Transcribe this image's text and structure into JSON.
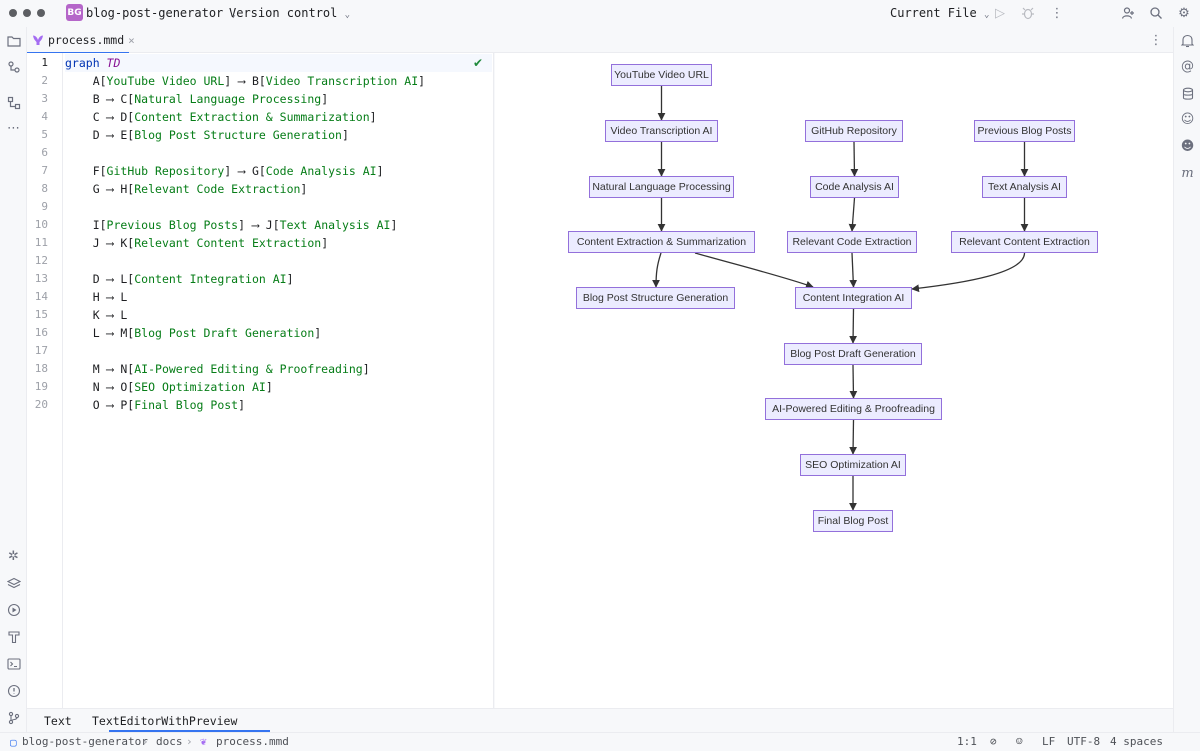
{
  "titlebar": {
    "project_badge": "BG",
    "project_name": "blog-post-generator",
    "vcs_label": "Version control",
    "run_config": "Current File"
  },
  "tab": {
    "file_name": "process.mmd"
  },
  "editor": {
    "line_numbers": [
      "1",
      "2",
      "3",
      "4",
      "5",
      "6",
      "7",
      "8",
      "9",
      "10",
      "11",
      "12",
      "13",
      "14",
      "15",
      "16",
      "17",
      "18",
      "19",
      "20"
    ],
    "lines": [
      {
        "segments": [
          {
            "t": "graph ",
            "c": "kw"
          },
          {
            "t": "TD",
            "c": "dir"
          }
        ]
      },
      {
        "segments": [
          {
            "t": "    A[",
            "c": ""
          },
          {
            "t": "YouTube Video URL",
            "c": "str"
          },
          {
            "t": "] ⟶ B[",
            "c": ""
          },
          {
            "t": "Video Transcription AI",
            "c": "str"
          },
          {
            "t": "]",
            "c": ""
          }
        ]
      },
      {
        "segments": [
          {
            "t": "    B ⟶ C[",
            "c": ""
          },
          {
            "t": "Natural Language Processing",
            "c": "str"
          },
          {
            "t": "]",
            "c": ""
          }
        ]
      },
      {
        "segments": [
          {
            "t": "    C ⟶ D[",
            "c": ""
          },
          {
            "t": "Content Extraction & Summarization",
            "c": "str"
          },
          {
            "t": "]",
            "c": ""
          }
        ]
      },
      {
        "segments": [
          {
            "t": "    D ⟶ E[",
            "c": ""
          },
          {
            "t": "Blog Post Structure Generation",
            "c": "str"
          },
          {
            "t": "]",
            "c": ""
          }
        ]
      },
      {
        "segments": [
          {
            "t": "",
            "c": ""
          }
        ]
      },
      {
        "segments": [
          {
            "t": "    F[",
            "c": ""
          },
          {
            "t": "GitHub Repository",
            "c": "str"
          },
          {
            "t": "] ⟶ G[",
            "c": ""
          },
          {
            "t": "Code Analysis AI",
            "c": "str"
          },
          {
            "t": "]",
            "c": ""
          }
        ]
      },
      {
        "segments": [
          {
            "t": "    G ⟶ H[",
            "c": ""
          },
          {
            "t": "Relevant Code Extraction",
            "c": "str"
          },
          {
            "t": "]",
            "c": ""
          }
        ]
      },
      {
        "segments": [
          {
            "t": "",
            "c": ""
          }
        ]
      },
      {
        "segments": [
          {
            "t": "    I[",
            "c": ""
          },
          {
            "t": "Previous Blog Posts",
            "c": "str"
          },
          {
            "t": "] ⟶ J[",
            "c": ""
          },
          {
            "t": "Text Analysis AI",
            "c": "str"
          },
          {
            "t": "]",
            "c": ""
          }
        ]
      },
      {
        "segments": [
          {
            "t": "    J ⟶ K[",
            "c": ""
          },
          {
            "t": "Relevant Content Extraction",
            "c": "str"
          },
          {
            "t": "]",
            "c": ""
          }
        ]
      },
      {
        "segments": [
          {
            "t": "",
            "c": ""
          }
        ]
      },
      {
        "segments": [
          {
            "t": "    D ⟶ L[",
            "c": ""
          },
          {
            "t": "Content Integration AI",
            "c": "str"
          },
          {
            "t": "]",
            "c": ""
          }
        ]
      },
      {
        "segments": [
          {
            "t": "    H ⟶ L",
            "c": ""
          }
        ]
      },
      {
        "segments": [
          {
            "t": "    K ⟶ L",
            "c": ""
          }
        ]
      },
      {
        "segments": [
          {
            "t": "    L ⟶ M[",
            "c": ""
          },
          {
            "t": "Blog Post Draft Generation",
            "c": "str"
          },
          {
            "t": "]",
            "c": ""
          }
        ]
      },
      {
        "segments": [
          {
            "t": "",
            "c": ""
          }
        ]
      },
      {
        "segments": [
          {
            "t": "    M ⟶ N[",
            "c": ""
          },
          {
            "t": "AI-Powered Editing & Proofreading",
            "c": "str"
          },
          {
            "t": "]",
            "c": ""
          }
        ]
      },
      {
        "segments": [
          {
            "t": "    N ⟶ O[",
            "c": ""
          },
          {
            "t": "SEO Optimization AI",
            "c": "str"
          },
          {
            "t": "]",
            "c": ""
          }
        ]
      },
      {
        "segments": [
          {
            "t": "    O ⟶ P[",
            "c": ""
          },
          {
            "t": "Final Blog Post",
            "c": "str"
          },
          {
            "t": "]",
            "c": ""
          }
        ]
      }
    ]
  },
  "diagram": {
    "nodes": {
      "A": "YouTube Video URL",
      "B": "Video Transcription AI",
      "C": "Natural Language Processing",
      "D": "Content Extraction & Summarization",
      "E": "Blog Post Structure Generation",
      "F": "GitHub Repository",
      "G": "Code Analysis AI",
      "H": "Relevant Code Extraction",
      "I": "Previous Blog Posts",
      "J": "Text Analysis AI",
      "K": "Relevant Content Extraction",
      "L": "Content Integration AI",
      "M": "Blog Post Draft Generation",
      "N": "AI-Powered Editing & Proofreading",
      "O": "SEO Optimization AI",
      "P": "Final Blog Post"
    }
  },
  "bottom_tabs": {
    "text": "Text",
    "text_with_preview": "TextEditorWithPreview"
  },
  "statusbar": {
    "crumb_project": "blog-post-generator",
    "crumb_folder": "docs",
    "crumb_file": "process.mmd",
    "position": "1:1",
    "line_ending": "LF",
    "encoding": "UTF-8",
    "indent": "4 spaces"
  },
  "colors": {
    "accent": "#3574f0",
    "node_fill": "#ececff",
    "node_border": "#9370db",
    "project_badge": "#b566c9"
  },
  "icons": [
    "project-folder-icon",
    "vcs-icon",
    "structure-icon",
    "more-icon",
    "run-icon",
    "debug-icon",
    "kebab-menu-icon",
    "add-user-icon",
    "search-icon",
    "settings-icon",
    "notifications-icon",
    "ai-assistant-icon",
    "database-icon",
    "copilot-icon",
    "markdown-icon",
    "plugins-icon",
    "layers-icon",
    "services-icon",
    "build-icon",
    "terminal-icon",
    "problems-icon",
    "git-icon",
    "check-icon"
  ]
}
